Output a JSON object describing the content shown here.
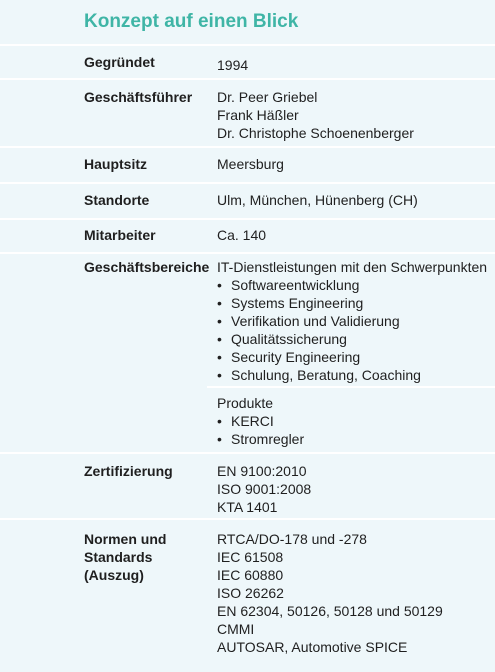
{
  "title": "Konzept auf einen Blick",
  "rows": {
    "gegruendet": {
      "label": "Gegründet",
      "lines": [
        "1994"
      ]
    },
    "geschaeftsfuehrer": {
      "label": "Geschäftsführer",
      "lines": [
        "Dr. Peer Griebel",
        "Frank Häßler",
        "Dr. Christophe Schoenenberger"
      ]
    },
    "hauptsitz": {
      "label": "Hauptsitz",
      "lines": [
        "Meersburg"
      ]
    },
    "standorte": {
      "label": "Standorte",
      "lines": [
        "Ulm, München, Hünenberg (CH)"
      ]
    },
    "mitarbeiter": {
      "label": "Mitarbeiter",
      "lines": [
        "Ca. 140"
      ]
    },
    "geschaeftsbereiche": {
      "label": "Geschäftsbereiche",
      "intro": "IT-Dienstleistungen mit den Schwerpunkten",
      "bullets": [
        "Softwareentwicklung",
        "Systems Engineering",
        "Verifikation und Validierung",
        "Qualitätssicherung",
        "Security Engineering",
        "Schulung, Beratung, Coaching"
      ],
      "produkte_label": "Produkte",
      "produkte": [
        "KERCI",
        "Stromregler"
      ]
    },
    "zertifizierung": {
      "label": "Zertifizierung",
      "lines": [
        "EN 9100:2010",
        "ISO 9001:2008",
        "KTA 1401"
      ]
    },
    "normen": {
      "label_lines": [
        "Normen und",
        "Standards",
        "(Auszug)"
      ],
      "lines": [
        "RTCA/DO-178 und -278",
        "IEC 61508",
        "IEC 60880",
        "ISO 26262",
        "EN 62304, 50126, 50128 und 50129",
        "CMMI",
        "AUTOSAR, Automotive SPICE"
      ]
    }
  },
  "bullet_glyph": "•"
}
